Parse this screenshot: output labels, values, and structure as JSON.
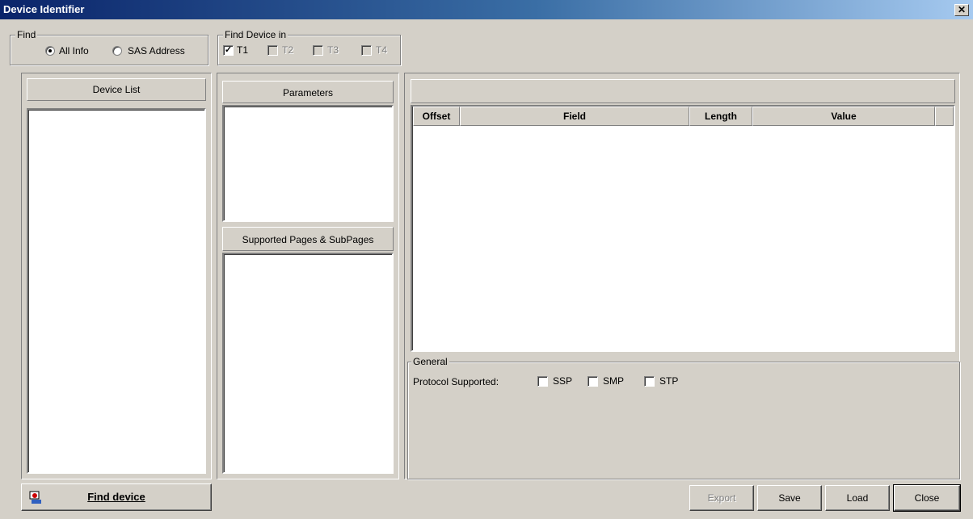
{
  "window": {
    "title": "Device Identifier",
    "close_glyph": "✕"
  },
  "find_group": {
    "legend": "Find",
    "options": [
      {
        "label": "All Info",
        "selected": true
      },
      {
        "label": "SAS Address",
        "selected": false
      }
    ]
  },
  "find_in_group": {
    "legend": "Find Device in",
    "targets": [
      {
        "label": "T1",
        "checked": true,
        "enabled": true
      },
      {
        "label": "T2",
        "checked": false,
        "enabled": false
      },
      {
        "label": "T3",
        "checked": false,
        "enabled": false
      },
      {
        "label": "T4",
        "checked": false,
        "enabled": false
      }
    ]
  },
  "device_list": {
    "header": "Device List"
  },
  "parameters": {
    "header": "Parameters"
  },
  "supported_pages": {
    "header": "Supported Pages & SubPages"
  },
  "detail_table": {
    "columns": [
      "Offset",
      "Field",
      "Length",
      "Value"
    ]
  },
  "general": {
    "legend": "General",
    "protocol_label": "Protocol Supported:",
    "protocols": [
      {
        "label": "SSP",
        "checked": false
      },
      {
        "label": "SMP",
        "checked": false
      },
      {
        "label": "STP",
        "checked": false
      }
    ]
  },
  "buttons": {
    "find_device": "Find device",
    "export": "Export",
    "save": "Save",
    "load": "Load",
    "close": "Close"
  }
}
